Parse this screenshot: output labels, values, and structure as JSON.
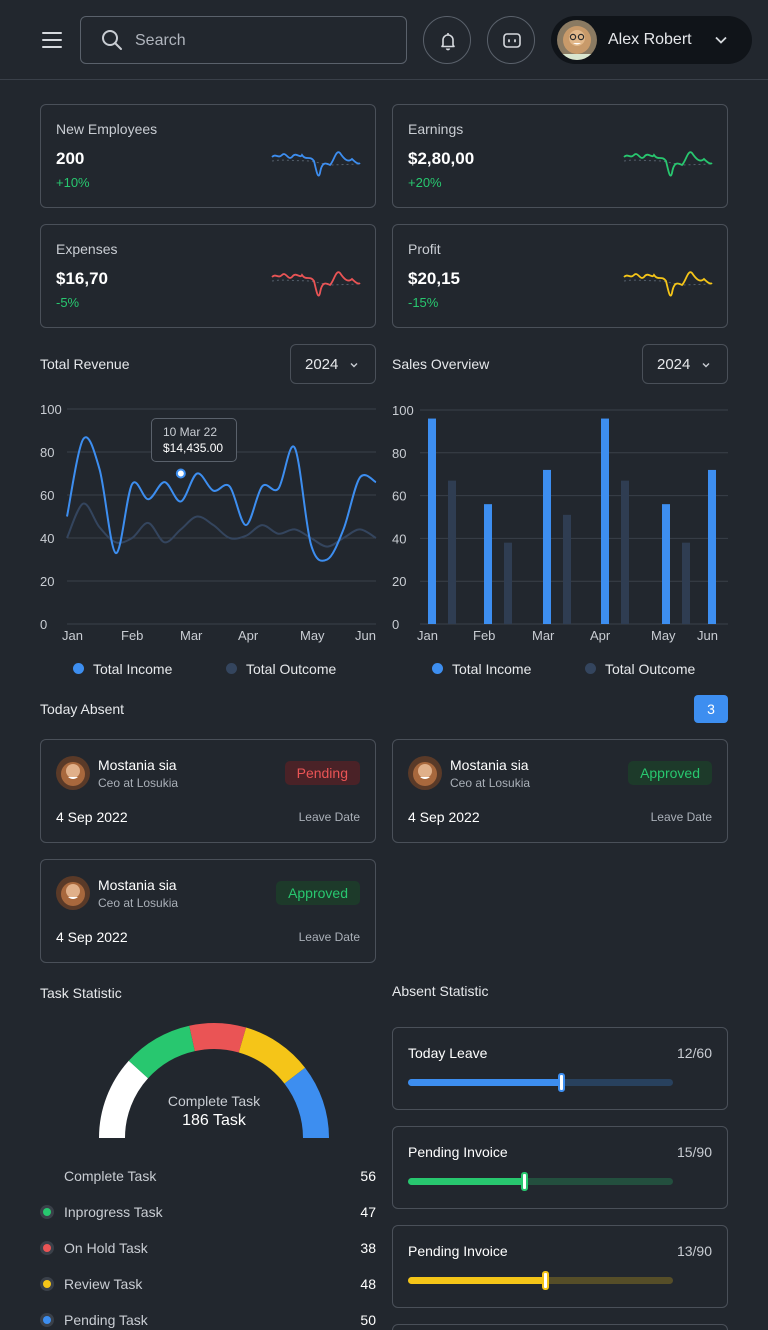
{
  "header": {
    "search_placeholder": "Search",
    "user_name": "Alex Robert"
  },
  "stats": [
    {
      "label": "New Employees",
      "value": "200",
      "change": "+10%",
      "color": "#3d8ef0"
    },
    {
      "label": "Earnings",
      "value": "$2,80,00",
      "change": "+20%",
      "color": "#28c76f"
    },
    {
      "label": "Expenses",
      "value": "$16,70",
      "change": "-5%",
      "color": "#ea5455"
    },
    {
      "label": "Profit",
      "value": "$20,15",
      "change": "-15%",
      "color": "#f5c518"
    }
  ],
  "revenue": {
    "title": "Total Revenue",
    "year": "2024",
    "tooltip_date": "10 Mar 22",
    "tooltip_value": "$14,435.00",
    "legend_income": "Total Income",
    "legend_outcome": "Total Outcome"
  },
  "sales": {
    "title": "Sales Overview",
    "year": "2024",
    "legend_income": "Total Income",
    "legend_outcome": "Total Outcome"
  },
  "chart_data": [
    {
      "type": "line",
      "title": "Total Revenue",
      "x": [
        "Jan",
        "Feb",
        "Mar",
        "Apr",
        "May",
        "Jun"
      ],
      "ylim": [
        0,
        100
      ],
      "yticks": [
        0,
        20,
        40,
        60,
        80,
        100
      ],
      "series": [
        {
          "name": "Total Income",
          "values": [
            50,
            86,
            72,
            33,
            65,
            58,
            66,
            57,
            70,
            62,
            64,
            46,
            64,
            63,
            82,
            37,
            30,
            44,
            68,
            66
          ]
        },
        {
          "name": "Total Outcome",
          "values": [
            40,
            56,
            45,
            38,
            40,
            47,
            38,
            44,
            50,
            46,
            40,
            41,
            46,
            42,
            44,
            40,
            36,
            40,
            44,
            40
          ]
        }
      ],
      "highlight": {
        "x": "Mar",
        "y": 70,
        "label": "$14,435.00",
        "date": "10 Mar 22"
      }
    },
    {
      "type": "bar",
      "title": "Sales Overview",
      "categories": [
        "Jan",
        "Feb",
        "Mar",
        "Apr",
        "May",
        "Jun"
      ],
      "ylim": [
        0,
        100
      ],
      "yticks": [
        0,
        20,
        40,
        60,
        80,
        100
      ],
      "series": [
        {
          "name": "Total Income",
          "values": [
            96,
            56,
            72,
            96,
            56,
            72
          ]
        },
        {
          "name": "Total Outcome",
          "values": [
            67,
            38,
            51,
            67,
            38
          ]
        }
      ]
    }
  ],
  "absent": {
    "title": "Today Absent",
    "count": "3",
    "items": [
      {
        "name": "Mostania sia",
        "role": "Ceo at Losukia",
        "date": "4 Sep 2022",
        "date_label": "Leave Date",
        "status": "Pending"
      },
      {
        "name": "Mostania sia",
        "role": "Ceo at Losukia",
        "date": "4 Sep 2022",
        "date_label": "Leave Date",
        "status": "Approved"
      },
      {
        "name": "Mostania sia",
        "role": "Ceo at Losukia",
        "date": "4 Sep 2022",
        "date_label": "Leave Date",
        "status": "Approved"
      }
    ]
  },
  "tasks": {
    "title": "Task Statistic",
    "center_label": "Complete Task",
    "center_value": "186 Task",
    "items": [
      {
        "label": "Complete Task",
        "value": "56",
        "color": "#ffffff"
      },
      {
        "label": "Inprogress Task",
        "value": "47",
        "color": "#28c76f"
      },
      {
        "label": "On Hold Task",
        "value": "38",
        "color": "#ea5455"
      },
      {
        "label": "Review Task",
        "value": "48",
        "color": "#f5c518"
      },
      {
        "label": "Pending Task",
        "value": "50",
        "color": "#3d8ef0"
      }
    ]
  },
  "absent_stats": {
    "title": "Absent Statistic",
    "items": [
      {
        "label": "Today Leave",
        "value": "12/60",
        "progress": 0.58,
        "color": "#3d8ef0"
      },
      {
        "label": "Pending Invoice",
        "value": "15/90",
        "progress": 0.44,
        "color": "#28c76f"
      },
      {
        "label": "Pending Invoice",
        "value": "13/90",
        "progress": 0.52,
        "color": "#f5c518"
      }
    ]
  }
}
